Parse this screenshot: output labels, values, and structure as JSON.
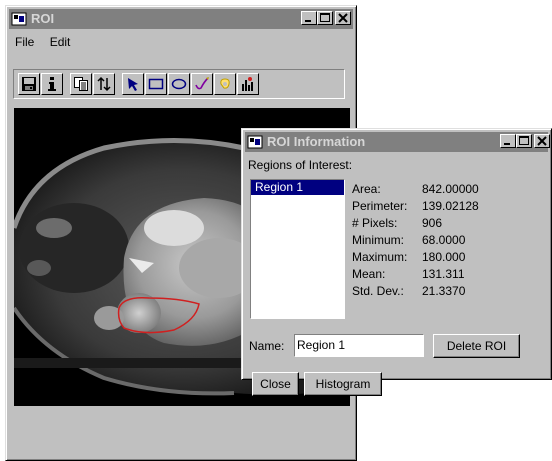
{
  "main_window": {
    "title": "ROI",
    "menu": [
      "File",
      "Edit"
    ],
    "toolbar_tools": [
      "save-icon",
      "info-icon",
      "copy-icon",
      "flip-icon",
      "arrow-icon",
      "rectangle-icon",
      "ellipse-icon",
      "freehand-icon",
      "region-grow-icon",
      "histogram-icon"
    ]
  },
  "dialog": {
    "title": "ROI Information",
    "list_label": "Regions of Interest:",
    "regions": [
      "Region 1"
    ],
    "stats": [
      {
        "label": "Area:",
        "value": "842.00000"
      },
      {
        "label": "Perimeter:",
        "value": "139.02128"
      },
      {
        "label": "# Pixels:",
        "value": "906"
      },
      {
        "label": "Minimum:",
        "value": "68.0000"
      },
      {
        "label": "Maximum:",
        "value": "180.000"
      },
      {
        "label": "Mean:",
        "value": "131.311"
      },
      {
        "label": "Std. Dev.:",
        "value": "21.3370"
      }
    ],
    "name_label": "Name:",
    "name_value": "Region 1",
    "delete_label": "Delete ROI",
    "close_label": "Close",
    "histogram_label": "Histogram"
  },
  "colors": {
    "inactive_title": "#808080",
    "list_selection": "#000080",
    "roi_outline": "#d02020"
  }
}
